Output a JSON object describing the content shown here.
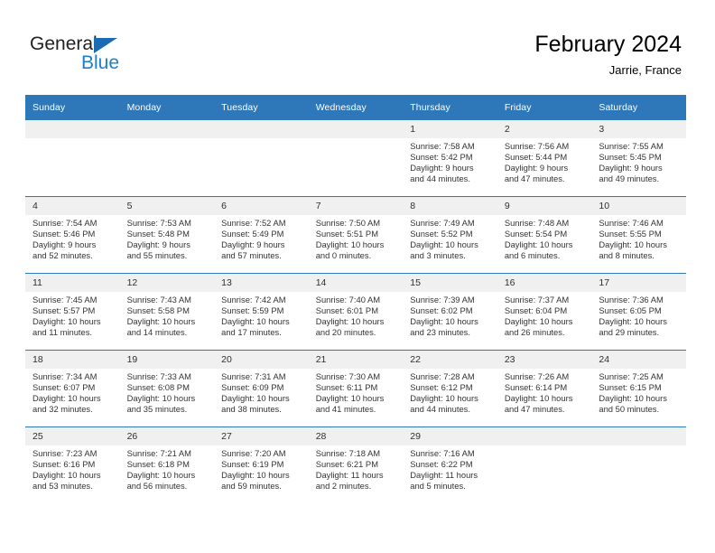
{
  "brand": {
    "name_part1": "General",
    "name_part2": "Blue",
    "accent_color": "#1b7fd0",
    "triangle_color": "#1b6cb5"
  },
  "header": {
    "title": "February 2024",
    "location": "Jarrie, France"
  },
  "theme": {
    "header_row_bg": "#2e77b8",
    "daynum_bg": "#f0f0f0",
    "row_divider": "#2e77b8"
  },
  "weekdays": [
    "Sunday",
    "Monday",
    "Tuesday",
    "Wednesday",
    "Thursday",
    "Friday",
    "Saturday"
  ],
  "weeks": [
    [
      {
        "day": "",
        "lines": []
      },
      {
        "day": "",
        "lines": []
      },
      {
        "day": "",
        "lines": []
      },
      {
        "day": "",
        "lines": []
      },
      {
        "day": "1",
        "lines": [
          "Sunrise: 7:58 AM",
          "Sunset: 5:42 PM",
          "Daylight: 9 hours",
          "and 44 minutes."
        ]
      },
      {
        "day": "2",
        "lines": [
          "Sunrise: 7:56 AM",
          "Sunset: 5:44 PM",
          "Daylight: 9 hours",
          "and 47 minutes."
        ]
      },
      {
        "day": "3",
        "lines": [
          "Sunrise: 7:55 AM",
          "Sunset: 5:45 PM",
          "Daylight: 9 hours",
          "and 49 minutes."
        ]
      }
    ],
    [
      {
        "day": "4",
        "lines": [
          "Sunrise: 7:54 AM",
          "Sunset: 5:46 PM",
          "Daylight: 9 hours",
          "and 52 minutes."
        ]
      },
      {
        "day": "5",
        "lines": [
          "Sunrise: 7:53 AM",
          "Sunset: 5:48 PM",
          "Daylight: 9 hours",
          "and 55 minutes."
        ]
      },
      {
        "day": "6",
        "lines": [
          "Sunrise: 7:52 AM",
          "Sunset: 5:49 PM",
          "Daylight: 9 hours",
          "and 57 minutes."
        ]
      },
      {
        "day": "7",
        "lines": [
          "Sunrise: 7:50 AM",
          "Sunset: 5:51 PM",
          "Daylight: 10 hours",
          "and 0 minutes."
        ]
      },
      {
        "day": "8",
        "lines": [
          "Sunrise: 7:49 AM",
          "Sunset: 5:52 PM",
          "Daylight: 10 hours",
          "and 3 minutes."
        ]
      },
      {
        "day": "9",
        "lines": [
          "Sunrise: 7:48 AM",
          "Sunset: 5:54 PM",
          "Daylight: 10 hours",
          "and 6 minutes."
        ]
      },
      {
        "day": "10",
        "lines": [
          "Sunrise: 7:46 AM",
          "Sunset: 5:55 PM",
          "Daylight: 10 hours",
          "and 8 minutes."
        ]
      }
    ],
    [
      {
        "day": "11",
        "lines": [
          "Sunrise: 7:45 AM",
          "Sunset: 5:57 PM",
          "Daylight: 10 hours",
          "and 11 minutes."
        ]
      },
      {
        "day": "12",
        "lines": [
          "Sunrise: 7:43 AM",
          "Sunset: 5:58 PM",
          "Daylight: 10 hours",
          "and 14 minutes."
        ]
      },
      {
        "day": "13",
        "lines": [
          "Sunrise: 7:42 AM",
          "Sunset: 5:59 PM",
          "Daylight: 10 hours",
          "and 17 minutes."
        ]
      },
      {
        "day": "14",
        "lines": [
          "Sunrise: 7:40 AM",
          "Sunset: 6:01 PM",
          "Daylight: 10 hours",
          "and 20 minutes."
        ]
      },
      {
        "day": "15",
        "lines": [
          "Sunrise: 7:39 AM",
          "Sunset: 6:02 PM",
          "Daylight: 10 hours",
          "and 23 minutes."
        ]
      },
      {
        "day": "16",
        "lines": [
          "Sunrise: 7:37 AM",
          "Sunset: 6:04 PM",
          "Daylight: 10 hours",
          "and 26 minutes."
        ]
      },
      {
        "day": "17",
        "lines": [
          "Sunrise: 7:36 AM",
          "Sunset: 6:05 PM",
          "Daylight: 10 hours",
          "and 29 minutes."
        ]
      }
    ],
    [
      {
        "day": "18",
        "lines": [
          "Sunrise: 7:34 AM",
          "Sunset: 6:07 PM",
          "Daylight: 10 hours",
          "and 32 minutes."
        ]
      },
      {
        "day": "19",
        "lines": [
          "Sunrise: 7:33 AM",
          "Sunset: 6:08 PM",
          "Daylight: 10 hours",
          "and 35 minutes."
        ]
      },
      {
        "day": "20",
        "lines": [
          "Sunrise: 7:31 AM",
          "Sunset: 6:09 PM",
          "Daylight: 10 hours",
          "and 38 minutes."
        ]
      },
      {
        "day": "21",
        "lines": [
          "Sunrise: 7:30 AM",
          "Sunset: 6:11 PM",
          "Daylight: 10 hours",
          "and 41 minutes."
        ]
      },
      {
        "day": "22",
        "lines": [
          "Sunrise: 7:28 AM",
          "Sunset: 6:12 PM",
          "Daylight: 10 hours",
          "and 44 minutes."
        ]
      },
      {
        "day": "23",
        "lines": [
          "Sunrise: 7:26 AM",
          "Sunset: 6:14 PM",
          "Daylight: 10 hours",
          "and 47 minutes."
        ]
      },
      {
        "day": "24",
        "lines": [
          "Sunrise: 7:25 AM",
          "Sunset: 6:15 PM",
          "Daylight: 10 hours",
          "and 50 minutes."
        ]
      }
    ],
    [
      {
        "day": "25",
        "lines": [
          "Sunrise: 7:23 AM",
          "Sunset: 6:16 PM",
          "Daylight: 10 hours",
          "and 53 minutes."
        ]
      },
      {
        "day": "26",
        "lines": [
          "Sunrise: 7:21 AM",
          "Sunset: 6:18 PM",
          "Daylight: 10 hours",
          "and 56 minutes."
        ]
      },
      {
        "day": "27",
        "lines": [
          "Sunrise: 7:20 AM",
          "Sunset: 6:19 PM",
          "Daylight: 10 hours",
          "and 59 minutes."
        ]
      },
      {
        "day": "28",
        "lines": [
          "Sunrise: 7:18 AM",
          "Sunset: 6:21 PM",
          "Daylight: 11 hours",
          "and 2 minutes."
        ]
      },
      {
        "day": "29",
        "lines": [
          "Sunrise: 7:16 AM",
          "Sunset: 6:22 PM",
          "Daylight: 11 hours",
          "and 5 minutes."
        ]
      },
      {
        "day": "",
        "lines": []
      },
      {
        "day": "",
        "lines": []
      }
    ]
  ]
}
